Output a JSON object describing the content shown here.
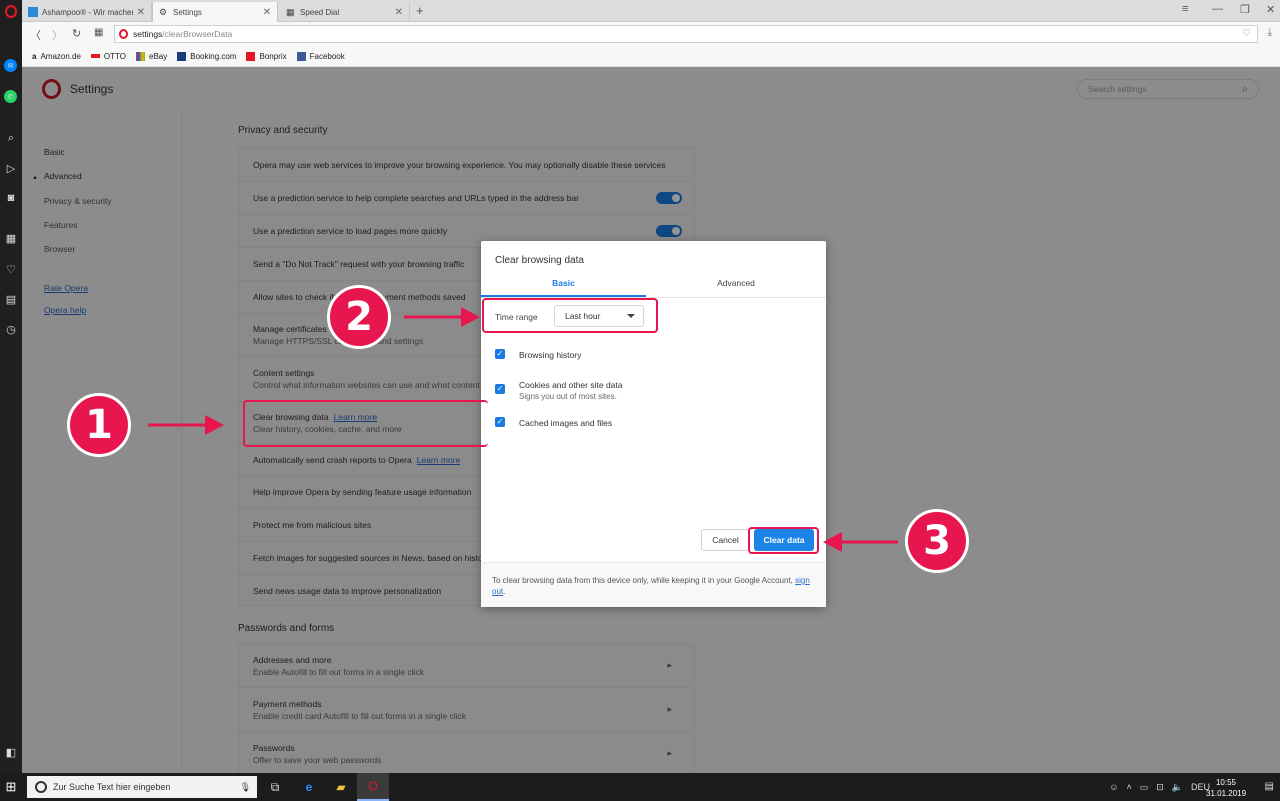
{
  "tabs": [
    {
      "title": "Ashampoo® - Wir machen",
      "icon": "ashampoo-icon"
    },
    {
      "title": "Settings",
      "icon": "gear-icon"
    },
    {
      "title": "Speed Dial",
      "icon": "grid-icon"
    }
  ],
  "address": {
    "host": "settings",
    "path": "/clearBrowserData"
  },
  "bookmarks": [
    "Amazon.de",
    "OTTO",
    "eBay",
    "Booking.com",
    "Bonprix",
    "Facebook"
  ],
  "settings": {
    "title": "Settings",
    "search_placeholder": "Search settings",
    "nav": {
      "basic": "Basic",
      "advanced": "Advanced",
      "privacy": "Privacy & security",
      "features": "Features",
      "browser": "Browser",
      "rate": "Rate Opera",
      "help": "Opera help"
    }
  },
  "privacy": {
    "title": "Privacy and security",
    "rows": [
      {
        "text": "Opera may use web services to improve your browsing experience. You may optionally disable these services"
      },
      {
        "text": "Use a prediction service to help complete searches and URLs typed in the address bar",
        "toggle": true
      },
      {
        "text": "Use a prediction service to load pages more quickly",
        "toggle": true
      },
      {
        "text": "Send a \"Do Not Track\" request with your browsing traffic"
      },
      {
        "text": "Allow sites to check if you have payment methods saved"
      },
      {
        "text": "Manage certificates",
        "sub": "Manage HTTPS/SSL certificates and settings"
      },
      {
        "text": "Content settings",
        "sub": "Control what information websites can use and what content they can show you"
      },
      {
        "text": "Clear browsing data",
        "link": "Learn more",
        "sub": "Clear history, cookies, cache, and more"
      },
      {
        "text": "Automatically send crash reports to Opera",
        "link": "Learn more"
      },
      {
        "text": "Help improve Opera by sending feature usage information"
      },
      {
        "text": "Protect me from malicious sites"
      },
      {
        "text": "Fetch images for suggested sources in News, based on history"
      },
      {
        "text": "Send news usage data to improve personalization"
      }
    ]
  },
  "passwords": {
    "title": "Passwords and forms",
    "rows": [
      {
        "text": "Addresses and more",
        "sub": "Enable Autofill to fill out forms in a single click"
      },
      {
        "text": "Payment methods",
        "sub": "Enable credit card Autofill to fill out forms in a single click"
      },
      {
        "text": "Passwords",
        "sub": "Offer to save your web passwords"
      }
    ]
  },
  "dialog": {
    "title": "Clear browsing data",
    "tab_basic": "Basic",
    "tab_advanced": "Advanced",
    "time_range_label": "Time range",
    "time_range_value": "Last hour",
    "checkboxes": [
      {
        "label": "Browsing history",
        "checked": true
      },
      {
        "label": "Cookies and other site data",
        "sub": "Signs you out of most sites.",
        "checked": true
      },
      {
        "label": "Cached images and files",
        "checked": true
      }
    ],
    "cancel": "Cancel",
    "clear": "Clear data",
    "footer_text": "To clear browsing data from this device only, while keeping it in your Google Account,",
    "footer_link": "sign out",
    "footer_end": "."
  },
  "annotations": [
    "1",
    "2",
    "3"
  ],
  "taskbar": {
    "search_placeholder": "Zur Suche Text hier eingeben",
    "lang": "DEU",
    "time": "10:55",
    "date": "31.01.2019"
  },
  "colors": {
    "accent": "#1b7be0",
    "annotation": "#e8164f",
    "opera_red": "#e51626"
  }
}
